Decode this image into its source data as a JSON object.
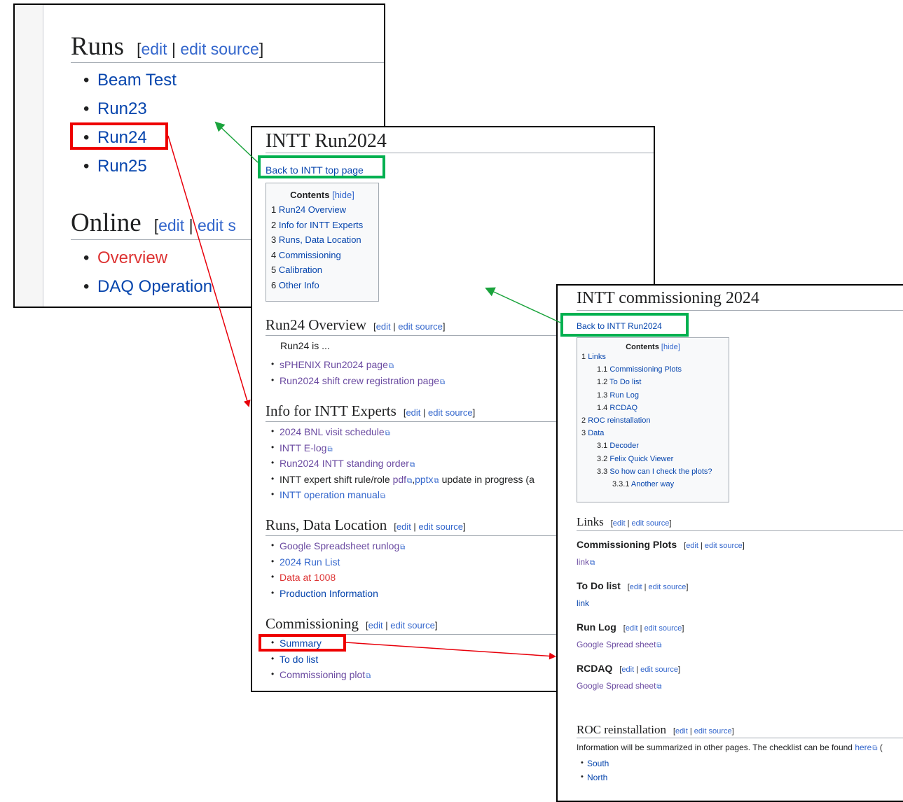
{
  "panel1": {
    "runs_title": "Runs",
    "online_title": "Online",
    "edit_text": "edit",
    "edit_source_text": "edit source",
    "edit_partial": "edit s",
    "runs_items": [
      "Beam Test",
      "Run23",
      "Run24",
      "Run25"
    ],
    "online_items": [
      "Overview",
      "DAQ Operation"
    ]
  },
  "panel2": {
    "title": "INTT Run2024",
    "back_link": "Back to INTT top page",
    "toc": {
      "title": "Contents",
      "hide": "[hide]",
      "items": [
        {
          "num": "1",
          "label": "Run24 Overview"
        },
        {
          "num": "2",
          "label": "Info for INTT Experts"
        },
        {
          "num": "3",
          "label": "Runs, Data Location"
        },
        {
          "num": "4",
          "label": "Commissioning"
        },
        {
          "num": "5",
          "label": "Calibration"
        },
        {
          "num": "6",
          "label": "Other Info"
        }
      ]
    },
    "edit_text": "edit",
    "edit_source_text": "edit source",
    "sections": {
      "overview": {
        "title": "Run24 Overview",
        "text": "Run24 is ...",
        "items": [
          "sPHENIX Run2024 page",
          "Run2024 shift crew registration page"
        ]
      },
      "experts": {
        "title": "Info for INTT Experts",
        "items": [
          "2024 BNL visit schedule",
          "INTT E-log",
          "Run2024 INTT standing order"
        ],
        "rule_prefix": "INTT expert shift rule/role ",
        "rule_pdf": "pdf",
        "rule_pptx": "pptx",
        "rule_suffix": " update in progress (a",
        "manual": "INTT operation manual"
      },
      "runs": {
        "title": "Runs, Data Location",
        "items": [
          "Google Spreadsheet runlog",
          "2024 Run List",
          "Data at 1008",
          "Production Information"
        ]
      },
      "commissioning": {
        "title": "Commissioning",
        "items": [
          "Summary",
          "To do list",
          "Commissioning plot"
        ]
      }
    }
  },
  "panel3": {
    "title": "INTT commissioning 2024",
    "back_link": "Back to INTT Run2024",
    "toc": {
      "title": "Contents",
      "hide": "[hide]",
      "items": [
        {
          "num": "1",
          "label": "Links",
          "level": 1
        },
        {
          "num": "1.1",
          "label": "Commissioning Plots",
          "level": 2
        },
        {
          "num": "1.2",
          "label": "To Do list",
          "level": 2
        },
        {
          "num": "1.3",
          "label": "Run Log",
          "level": 2
        },
        {
          "num": "1.4",
          "label": "RCDAQ",
          "level": 2
        },
        {
          "num": "2",
          "label": "ROC reinstallation",
          "level": 1
        },
        {
          "num": "3",
          "label": "Data",
          "level": 1
        },
        {
          "num": "3.1",
          "label": "Decoder",
          "level": 2
        },
        {
          "num": "3.2",
          "label": "Felix Quick Viewer",
          "level": 2
        },
        {
          "num": "3.3",
          "label": "So how can I check the plots?",
          "level": 2
        },
        {
          "num": "3.3.1",
          "label": "Another way",
          "level": 3
        }
      ]
    },
    "edit_text": "edit",
    "edit_source_text": "edit source",
    "links_title": "Links",
    "commissioning_plots": {
      "title": "Commissioning Plots",
      "link": "link"
    },
    "todo": {
      "title": "To Do list",
      "link": "link"
    },
    "runlog": {
      "title": "Run Log",
      "link": "Google Spread sheet"
    },
    "rcdaq": {
      "title": "RCDAQ",
      "link": "Google Spread sheet"
    },
    "roc": {
      "title": "ROC reinstallation",
      "text": "Information will be summarized in other pages. The checklist can be found ",
      "here": "here",
      "tail": " (",
      "items": [
        "South",
        "North"
      ]
    }
  },
  "colors": {
    "link": "#3366cc",
    "visited": "#6b4ba1",
    "redlink": "#d33",
    "highlight_red": "#ee0000",
    "highlight_green": "#00b050",
    "arrow_red": "#e8000b",
    "arrow_green": "#1aa33c"
  }
}
